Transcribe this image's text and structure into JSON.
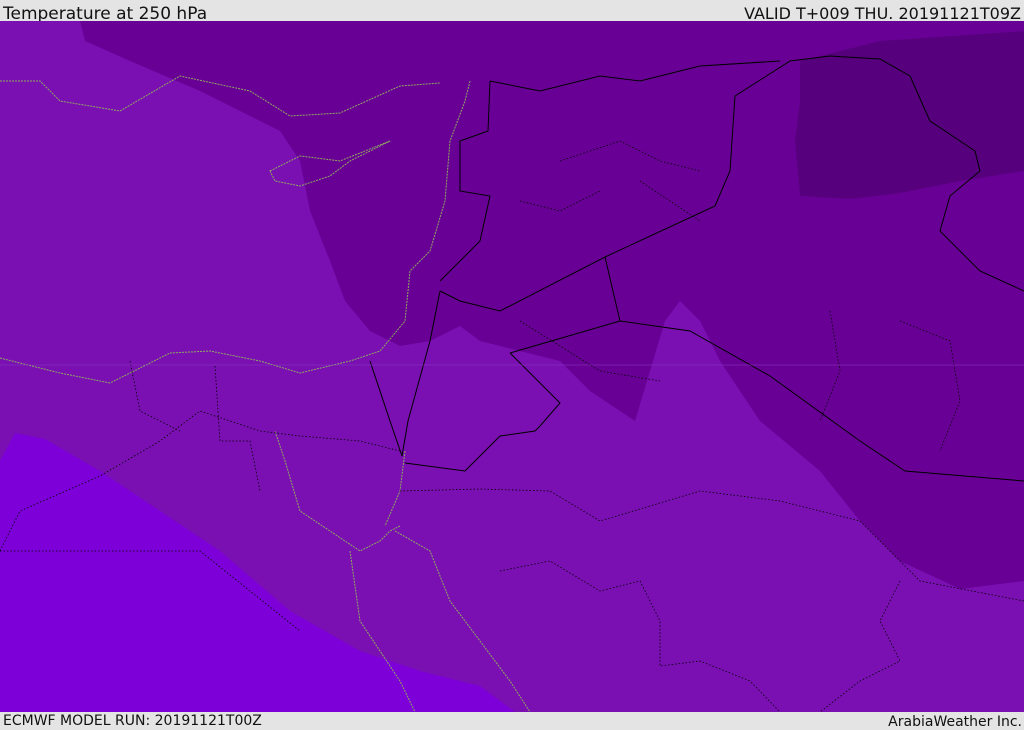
{
  "header": {
    "title": "Temperature at 250 hPa",
    "valid": "VALID T+009 THU. 20191121T09Z"
  },
  "footer": {
    "model_run": "ECMWF MODEL RUN: 20191121T00Z",
    "brand": "ArabiaWeather Inc."
  },
  "colors": {
    "coldest": "#57007e",
    "cold": "#690096",
    "mid": "#7a10b2",
    "warm": "#7d00d8",
    "coast": "#8fa860",
    "border": "#000000"
  }
}
